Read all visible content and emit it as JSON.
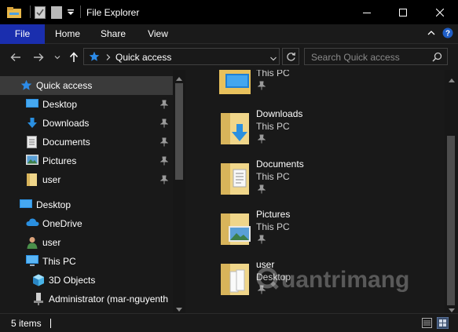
{
  "window": {
    "title": "File Explorer",
    "accent_color": "#1a2eae"
  },
  "ribbon": {
    "tabs": [
      {
        "label": "File"
      },
      {
        "label": "Home"
      },
      {
        "label": "Share"
      },
      {
        "label": "View"
      }
    ]
  },
  "address": {
    "current_location": "Quick access",
    "search_placeholder": "Search Quick access"
  },
  "nav_pane": {
    "items": [
      {
        "label": "Quick access",
        "icon": "star-icon",
        "selected": true
      },
      {
        "label": "Desktop",
        "icon": "desktop-icon",
        "pinned": true
      },
      {
        "label": "Downloads",
        "icon": "download-arrow-icon",
        "pinned": true
      },
      {
        "label": "Documents",
        "icon": "document-icon",
        "pinned": true
      },
      {
        "label": "Pictures",
        "icon": "pictures-icon",
        "pinned": true
      },
      {
        "label": "user",
        "icon": "folder-icon",
        "pinned": true
      },
      {
        "label": "Desktop",
        "icon": "desktop-icon"
      },
      {
        "label": "OneDrive",
        "icon": "cloud-icon"
      },
      {
        "label": "user",
        "icon": "user-icon"
      },
      {
        "label": "This PC",
        "icon": "computer-icon"
      },
      {
        "label": "3D Objects",
        "icon": "cube-icon"
      },
      {
        "label": "Administrator (mar-nguyenth",
        "icon": "network-drive-icon"
      }
    ]
  },
  "content": {
    "items": [
      {
        "name": "",
        "location": "This PC",
        "icon": "desktop-folder-icon"
      },
      {
        "name": "Downloads",
        "location": "This PC",
        "icon": "downloads-folder-icon"
      },
      {
        "name": "Documents",
        "location": "This PC",
        "icon": "documents-folder-icon"
      },
      {
        "name": "Pictures",
        "location": "This PC",
        "icon": "pictures-folder-icon"
      },
      {
        "name": "user",
        "location": "Desktop",
        "icon": "user-folder-icon"
      }
    ]
  },
  "status": {
    "item_count": "5 items"
  },
  "watermark": {
    "text": "uantrimang"
  }
}
